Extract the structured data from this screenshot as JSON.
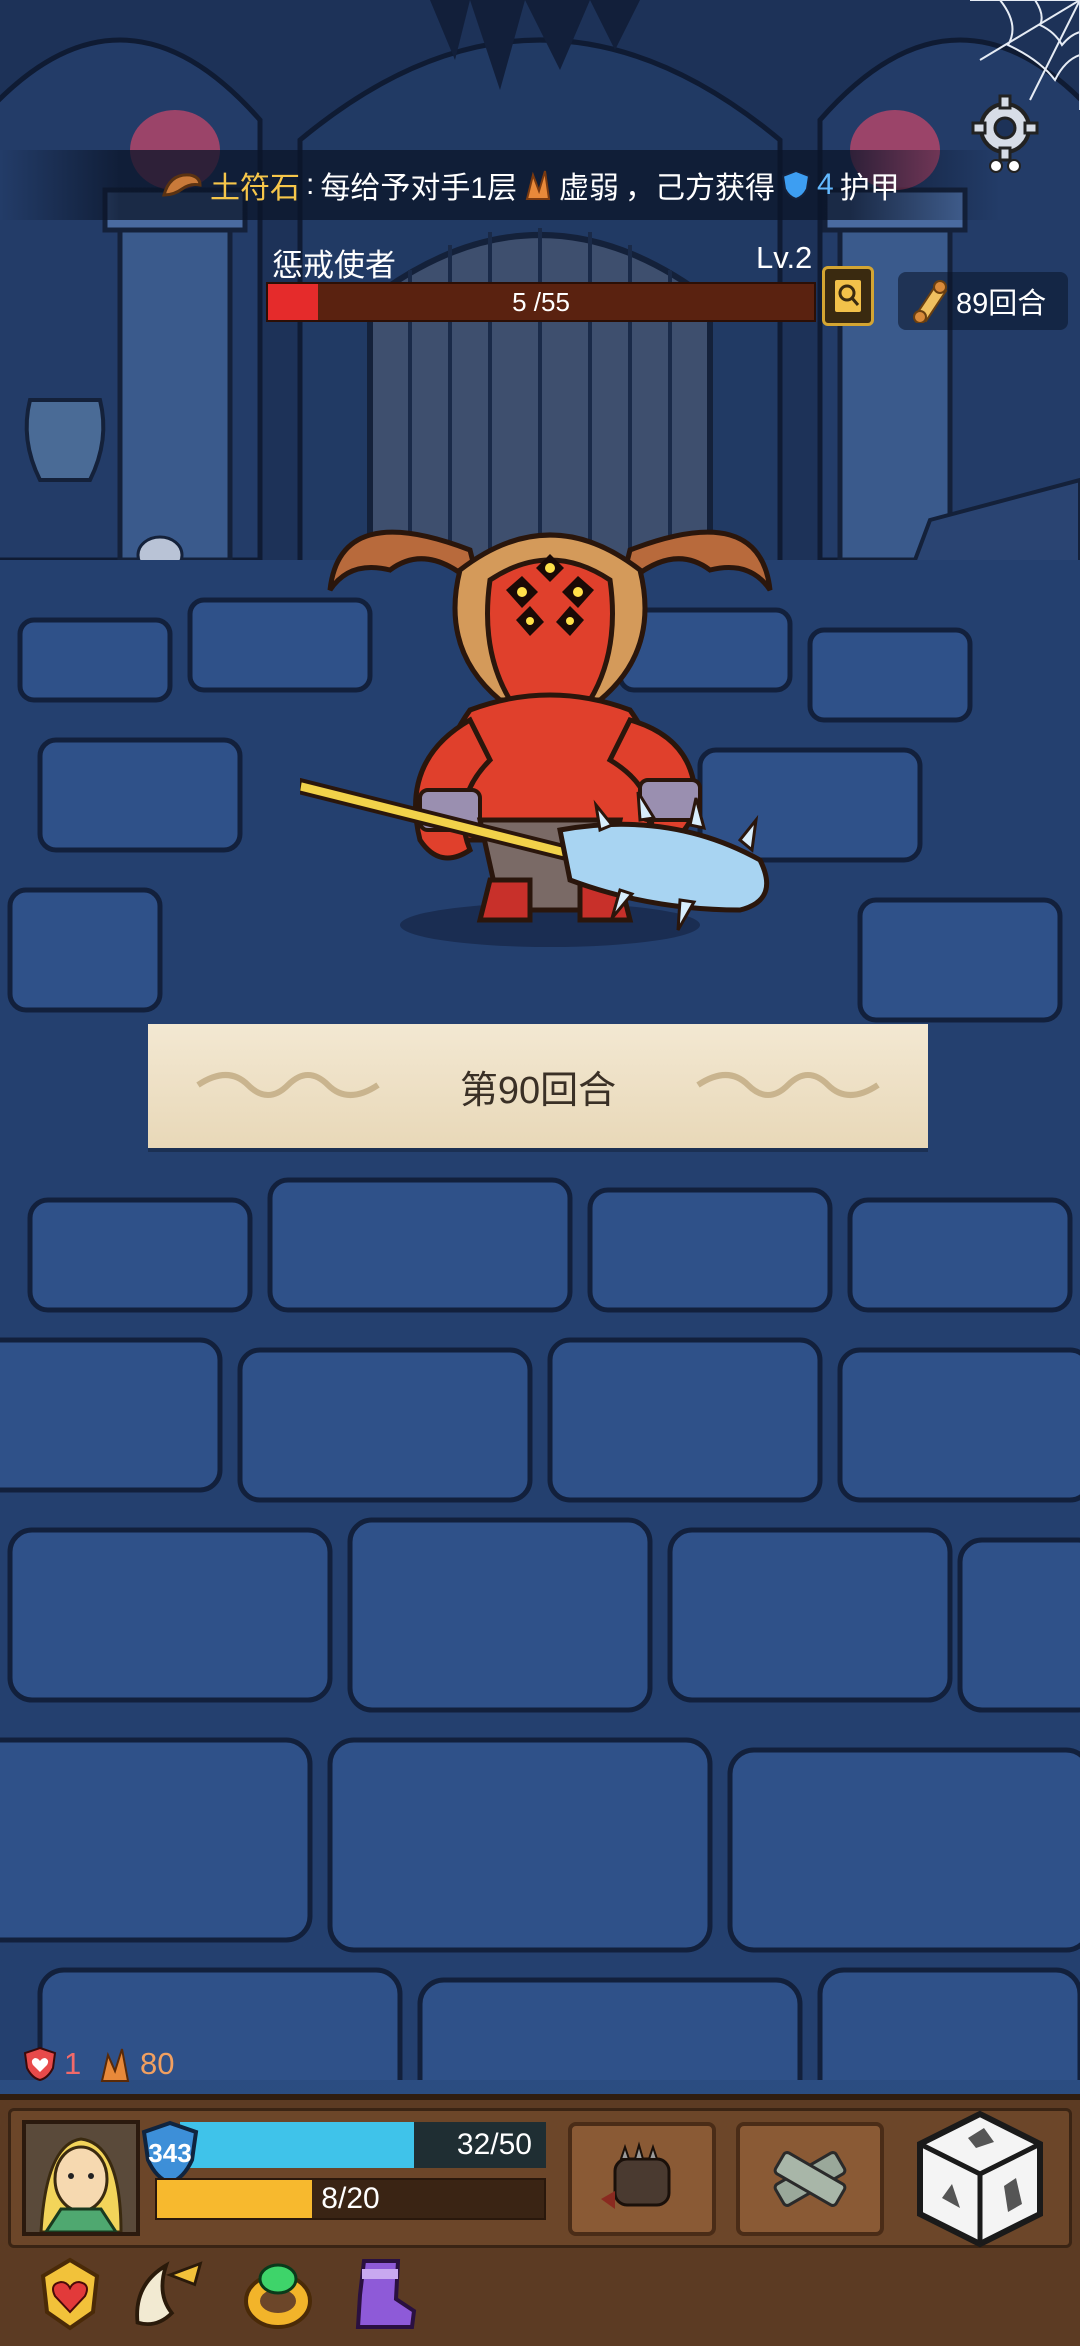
{
  "rune": {
    "name": "土符石",
    "effect_prefix": "每给予对手1层",
    "debuff": "虚弱",
    "mid": "，己方获得",
    "armor_amount": "4",
    "armor_word": "护甲"
  },
  "enemy": {
    "name": "惩戒使者",
    "level": "Lv.2",
    "hp_text": "5 /55",
    "hp_current": 5,
    "hp_max": 55
  },
  "turns_remaining": "89回合",
  "round_banner": "第90回合",
  "statuses": {
    "shield_count": "1",
    "weak_count": "80"
  },
  "player": {
    "armor": "343",
    "hp_text": "32/50",
    "hp_current": 32,
    "hp_max": 50,
    "energy_text": "8/20",
    "energy_current": 8,
    "energy_max": 20
  },
  "colors": {
    "enemy_hp": "#e52b2b",
    "player_hp": "#3fc3ea",
    "energy": "#f7b92e",
    "rune_name": "#f6c64a",
    "armor_text": "#63b9ff"
  },
  "icons": {
    "settings": "gear-icon",
    "codex": "magnifier-book-icon",
    "turns": "scroll-icon",
    "skill1": "spiked-fist-icon",
    "skill2": "bandage-icon",
    "dice": "dice-icon",
    "relics": [
      "heart-amulet-icon",
      "horn-icon",
      "emerald-ring-icon",
      "purple-boot-icon"
    ]
  }
}
